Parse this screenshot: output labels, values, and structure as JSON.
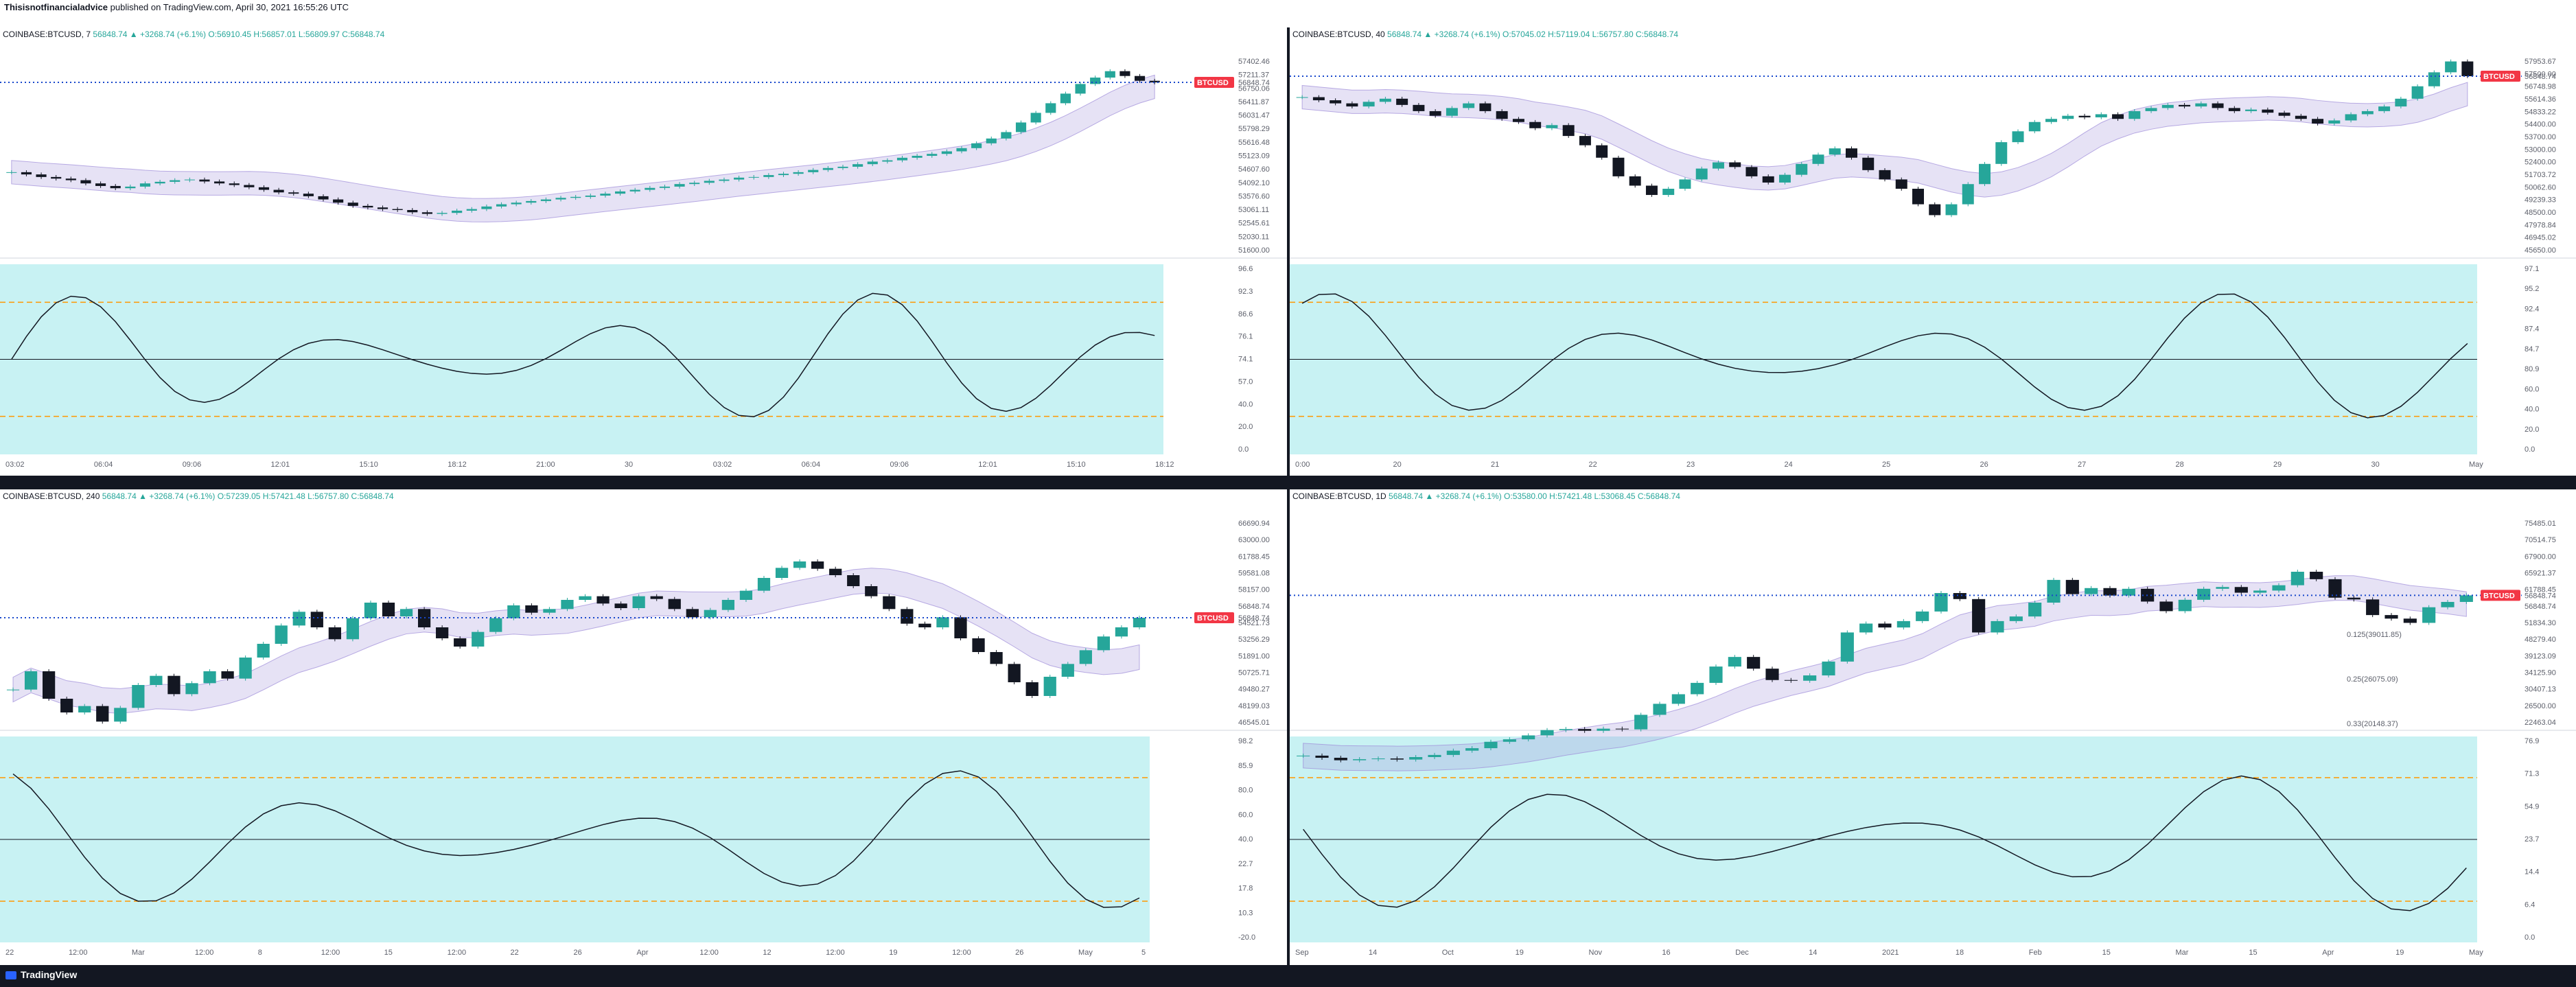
{
  "header": {
    "author": "Thisisnotfinancialadvice",
    "published": "published on TradingView.com, April 30, 2021 16:55:26 UTC"
  },
  "footer": {
    "brand": "TradingView"
  },
  "colors": {
    "up": "#26a69a",
    "down": "#131722",
    "cyan_fill": "#c8f2f3",
    "purple_band": "#9c8ad8",
    "price_tag": "#f23645",
    "dotted_level": "#1848cc",
    "oscillator_orange": "#ff9800",
    "annotation_red": "#e53935"
  },
  "chart_data": [
    {
      "id": "7m",
      "type": "candlestick",
      "title": "COINBASE:BTCUSD, 7",
      "ohlc_text": "56848.74 ▲ +3268.74 (+6.1%) O:56910.45 H:56857.01 L:56809.97 C:56848.74",
      "price_tag": "56848.74",
      "price_axis": [
        "57402.46",
        "57211.37",
        "56750.06",
        "56411.87",
        "56031.47",
        "55798.29",
        "55616.48",
        "55123.09",
        "54607.60",
        "54092.10",
        "53576.60",
        "53061.11",
        "52545.61",
        "52030.11",
        "51600.00"
      ],
      "price_range": [
        51500,
        57600
      ],
      "osc_axis": [
        "96.6",
        "92.3",
        "86.6",
        "76.1",
        "74.1",
        "57.0",
        "40.0",
        "20.0",
        "0.0"
      ],
      "time_labels": [
        "03:02",
        "06:04",
        "09:06",
        "12:01",
        "15:10",
        "18:12",
        "21:00",
        "30",
        "03:02",
        "06:04",
        "09:06",
        "12:01",
        "15:10",
        "18:12"
      ],
      "close": [
        54050,
        53980,
        53900,
        53850,
        53800,
        53700,
        53620,
        53550,
        53600,
        53700,
        53750,
        53800,
        53820,
        53760,
        53700,
        53650,
        53580,
        53500,
        53420,
        53380,
        53300,
        53200,
        53100,
        53000,
        52950,
        52900,
        52870,
        52800,
        52750,
        52780,
        52850,
        52900,
        52980,
        53050,
        53100,
        53150,
        53200,
        53250,
        53280,
        53320,
        53380,
        53450,
        53500,
        53560,
        53600,
        53680,
        53720,
        53780,
        53820,
        53880,
        53900,
        53960,
        54000,
        54050,
        54120,
        54180,
        54220,
        54300,
        54380,
        54420,
        54500,
        54560,
        54620,
        54700,
        54800,
        54950,
        55100,
        55300,
        55600,
        55900,
        56200,
        56500,
        56800,
        57000,
        57200,
        57050,
        56900,
        56850
      ]
    },
    {
      "id": "40m",
      "type": "candlestick",
      "title": "COINBASE:BTCUSD, 40",
      "ohlc_text": "56848.74 ▲ +3268.74 (+6.1%) O:57045.02 H:57119.04 L:56757.80 C:56848.74",
      "price_tag": "56848.74",
      "price_axis": [
        "57953.67",
        "57500.00",
        "56748.98",
        "55614.36",
        "54833.22",
        "54400.00",
        "53700.00",
        "53000.00",
        "52400.00",
        "51703.72",
        "50062.60",
        "49239.33",
        "48500.00",
        "47978.84",
        "46945.02",
        "45650.00"
      ],
      "price_range": [
        45400,
        58000
      ],
      "osc_axis": [
        "97.1",
        "95.2",
        "92.4",
        "87.4",
        "84.7",
        "80.9",
        "60.0",
        "40.0",
        "20.0",
        "0.0"
      ],
      "time_labels": [
        "0:00",
        "20",
        "21",
        "22",
        "23",
        "24",
        "25",
        "26",
        "27",
        "28",
        "29",
        "30",
        "May"
      ],
      "close": [
        55500,
        55300,
        55100,
        54900,
        55200,
        55400,
        55000,
        54600,
        54300,
        54800,
        55100,
        54600,
        54100,
        53900,
        53500,
        53700,
        53000,
        52400,
        51600,
        50400,
        49800,
        49200,
        49600,
        50200,
        50900,
        51300,
        51000,
        50400,
        50000,
        50500,
        51200,
        51800,
        52200,
        51600,
        50800,
        50200,
        49600,
        48600,
        47900,
        48600,
        49900,
        51200,
        52600,
        53300,
        53900,
        54100,
        54300,
        54200,
        54400,
        54100,
        54600,
        54800,
        55000,
        54900,
        55100,
        54800,
        54600,
        54700,
        54500,
        54300,
        54100,
        53800,
        54000,
        54400,
        54600,
        54900,
        55400,
        56200,
        57100,
        57800,
        56850
      ]
    },
    {
      "id": "240m",
      "type": "candlestick",
      "title": "COINBASE:BTCUSD, 240",
      "ohlc_text": "56848.74 ▲ +3268.74 (+6.1%) O:57239.05 H:57421.48 L:56757.80 C:56848.74",
      "price_tag": "56848.74",
      "price_axis": [
        "66690.94",
        "63000.00",
        "61788.45",
        "59581.08",
        "58157.00",
        "56848.74",
        "54521.73",
        "53256.29",
        "51891.00",
        "50725.71",
        "49480.27",
        "48199.03",
        "46545.01"
      ],
      "price_range": [
        45000,
        67500
      ],
      "osc_axis": [
        "98.2",
        "85.9",
        "80.0",
        "60.0",
        "40.0",
        "22.7",
        "17.8",
        "10.3",
        "-20.0"
      ],
      "time_labels": [
        "22",
        "12:00",
        "Mar",
        "12:00",
        "8",
        "12:00",
        "15",
        "12:00",
        "22",
        "26",
        "Apr",
        "12:00",
        "12",
        "12:00",
        "19",
        "12:00",
        "26",
        "May",
        "5"
      ],
      "close": [
        49000,
        51000,
        48000,
        46500,
        47200,
        45500,
        47000,
        49500,
        50500,
        48500,
        49700,
        51000,
        50200,
        52500,
        54000,
        56000,
        57500,
        55800,
        54500,
        56800,
        58500,
        57000,
        57800,
        55800,
        54600,
        53700,
        55300,
        56800,
        58200,
        57400,
        57800,
        58800,
        59200,
        58400,
        57900,
        59200,
        58900,
        57800,
        56900,
        57700,
        58800,
        59800,
        61200,
        62300,
        63000,
        62200,
        61500,
        60300,
        59200,
        57800,
        56200,
        55800,
        56900,
        54600,
        53100,
        51800,
        49800,
        48300,
        50400,
        51800,
        53300,
        54800,
        55800,
        56848
      ]
    },
    {
      "id": "1D",
      "type": "candlestick",
      "title": "COINBASE:BTCUSD, 1D",
      "ohlc_text": "56848.74 ▲ +3268.74 (+6.1%) O:53580.00 H:57421.48 L:53068.45 C:56848.74",
      "price_tag": "56848.74",
      "price_axis": [
        "75485.01",
        "70514.75",
        "67900.00",
        "65921.37",
        "61788.45",
        "56848.74",
        "51834.30",
        "48279.40",
        "39123.09",
        "34125.90",
        "30407.13",
        "26500.00",
        "22463.04"
      ],
      "price_range": [
        20000,
        78000
      ],
      "fib_labels": [
        "0.125(39011.85)",
        "0.25(26075.09)",
        "0.33(20148.37)"
      ],
      "osc_axis": [
        "76.9",
        "71.3",
        "54.9",
        "23.7",
        "14.4",
        "6.4",
        "0.0"
      ],
      "time_labels": [
        "Sep",
        "14",
        "Oct",
        "19",
        "Nov",
        "16",
        "Dec",
        "14",
        "2021",
        "18",
        "Feb",
        "15",
        "Mar",
        "15",
        "Apr",
        "19",
        "May"
      ],
      "close": [
        11700,
        11100,
        10400,
        10700,
        10900,
        10600,
        11300,
        11900,
        13100,
        13800,
        15600,
        16300,
        17400,
        18900,
        19200,
        18700,
        19300,
        19100,
        23200,
        26300,
        29000,
        32200,
        36800,
        39500,
        36200,
        33000,
        32800,
        34300,
        38200,
        46400,
        48900,
        47800,
        49600,
        52300,
        57500,
        55800,
        46400,
        49600,
        50900,
        54800,
        61200,
        57200,
        58900,
        56800,
        58700,
        55100,
        52400,
        55600,
        58700,
        59200,
        57600,
        58200,
        59700,
        63500,
        61400,
        56200,
        55700,
        51300,
        50300,
        49100,
        53500,
        55000,
        56848
      ]
    }
  ]
}
